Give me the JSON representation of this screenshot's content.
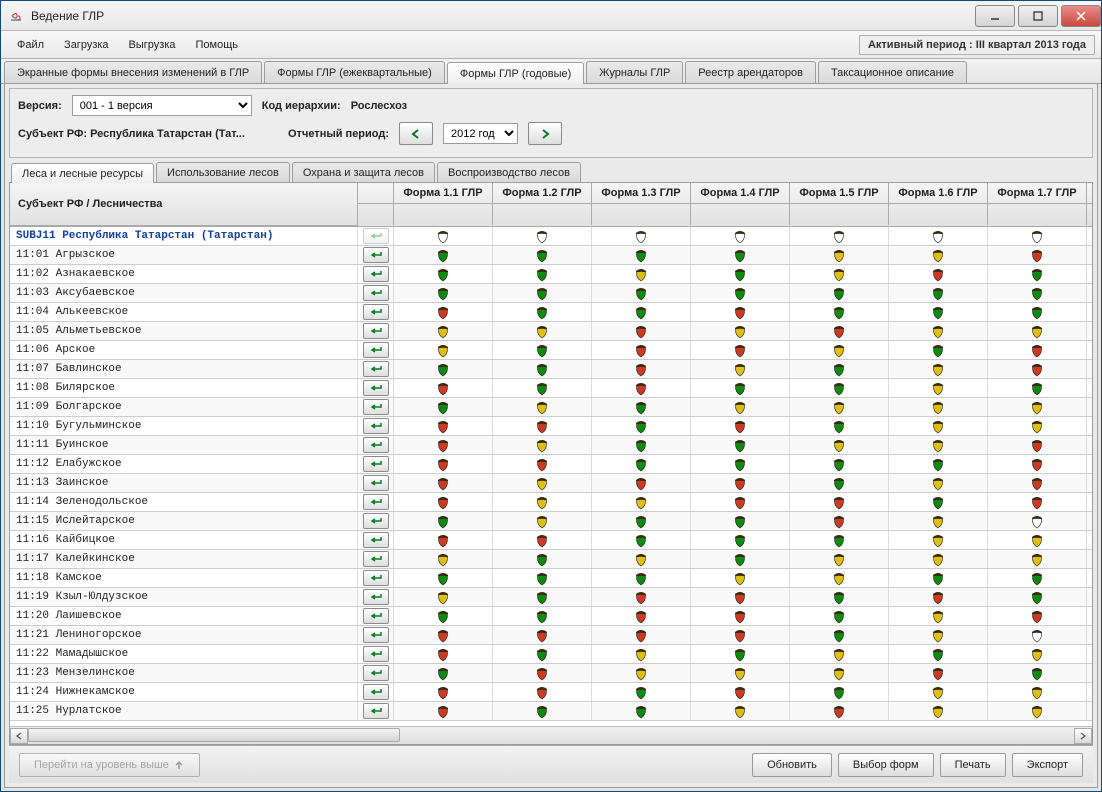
{
  "title": "Ведение ГЛР",
  "menu": [
    "Файл",
    "Загрузка",
    "Выгрузка",
    "Помощь"
  ],
  "active_period": "Активный период : III квартал  2013 года",
  "tabs": [
    "Экранные формы внесения изменений в ГЛР",
    "Формы ГЛР (ежеквартальные)",
    "Формы ГЛР (годовые)",
    "Журналы ГЛР",
    "Реестр арендаторов",
    "Таксационное описание"
  ],
  "tabs_active_index": 2,
  "filters": {
    "version_label": "Версия:",
    "version_value": "001 - 1 версия",
    "hierarchy_label": "Код иерархии:",
    "hierarchy_value": "Рослесхоз",
    "subject_label": "Субъект РФ: Республика Татарстан (Тат...",
    "period_label": "Отчетный период:",
    "period_value": "2012 год"
  },
  "subtabs": [
    "Леса и лесные ресурсы",
    "Использование лесов",
    "Охрана и защита лесов",
    "Воспроизводство лесов"
  ],
  "subtabs_active_index": 0,
  "columns": {
    "subject": "Субъект РФ / Лесничества",
    "forms": [
      "Форма 1.1 ГЛР",
      "Форма 1.2 ГЛР",
      "Форма 1.3 ГЛР",
      "Форма 1.4 ГЛР",
      "Форма 1.5 ГЛР",
      "Форма 1.6 ГЛР",
      "Форма 1.7 ГЛР"
    ]
  },
  "rows": [
    {
      "code": "SUBJ11 Республика Татарстан (Татарстан)",
      "root": true,
      "btn": "disabled",
      "c": [
        "w",
        "w",
        "w",
        "w",
        "w",
        "w",
        "w"
      ]
    },
    {
      "code": "11:01 Агрызское",
      "c": [
        "g",
        "g",
        "g",
        "g",
        "y",
        "y",
        "r"
      ]
    },
    {
      "code": "11:02 Азнакаевское",
      "c": [
        "g",
        "g",
        "y",
        "g",
        "y",
        "r",
        "g"
      ]
    },
    {
      "code": "11:03 Аксубаевское",
      "c": [
        "g",
        "g",
        "g",
        "g",
        "g",
        "g",
        "g"
      ]
    },
    {
      "code": "11:04 Алькеевское",
      "c": [
        "r",
        "g",
        "g",
        "r",
        "g",
        "g",
        "g"
      ]
    },
    {
      "code": "11:05 Альметьевское",
      "c": [
        "y",
        "y",
        "r",
        "y",
        "r",
        "y",
        "y"
      ]
    },
    {
      "code": "11:06 Арское",
      "c": [
        "y",
        "g",
        "r",
        "r",
        "y",
        "g",
        "r"
      ]
    },
    {
      "code": "11:07 Бавлинское",
      "c": [
        "g",
        "g",
        "r",
        "y",
        "g",
        "y",
        "r"
      ]
    },
    {
      "code": "11:08 Билярское",
      "c": [
        "r",
        "g",
        "r",
        "g",
        "g",
        "y",
        "g"
      ]
    },
    {
      "code": "11:09 Болгарское",
      "c": [
        "g",
        "y",
        "g",
        "y",
        "y",
        "y",
        "y"
      ]
    },
    {
      "code": "11:10 Бугульминское",
      "c": [
        "r",
        "r",
        "g",
        "r",
        "g",
        "y",
        "y"
      ]
    },
    {
      "code": "11:11 Буинское",
      "c": [
        "r",
        "y",
        "g",
        "g",
        "y",
        "y",
        "r"
      ]
    },
    {
      "code": "11:12 Елабужское",
      "c": [
        "r",
        "r",
        "g",
        "g",
        "g",
        "g",
        "r"
      ]
    },
    {
      "code": "11:13 Заинское",
      "c": [
        "r",
        "y",
        "r",
        "r",
        "g",
        "y",
        "r"
      ]
    },
    {
      "code": "11:14 Зеленодольское",
      "c": [
        "r",
        "y",
        "y",
        "r",
        "r",
        "g",
        "r"
      ]
    },
    {
      "code": "11:15 Ислейтарское",
      "c": [
        "g",
        "y",
        "g",
        "g",
        "r",
        "y",
        "w"
      ]
    },
    {
      "code": "11:16 Кайбицкое",
      "c": [
        "r",
        "r",
        "g",
        "g",
        "g",
        "y",
        "y"
      ]
    },
    {
      "code": "11:17 Калейкинское",
      "c": [
        "y",
        "g",
        "y",
        "g",
        "y",
        "y",
        "y"
      ]
    },
    {
      "code": "11:18 Камское",
      "c": [
        "g",
        "g",
        "g",
        "y",
        "y",
        "g",
        "g"
      ]
    },
    {
      "code": "11:19 Кзыл-Юлдузское",
      "c": [
        "y",
        "g",
        "r",
        "r",
        "g",
        "r",
        "g"
      ]
    },
    {
      "code": "11:20 Лаишевское",
      "c": [
        "g",
        "g",
        "r",
        "r",
        "g",
        "y",
        "r"
      ]
    },
    {
      "code": "11:21 Лениногорское",
      "c": [
        "r",
        "r",
        "r",
        "r",
        "g",
        "y",
        "w"
      ]
    },
    {
      "code": "11:22 Мамадышское",
      "c": [
        "r",
        "g",
        "y",
        "g",
        "y",
        "g",
        "y"
      ]
    },
    {
      "code": "11:23 Мензелинское",
      "c": [
        "g",
        "r",
        "y",
        "y",
        "y",
        "r",
        "g"
      ]
    },
    {
      "code": "11:24 Нижнекамское",
      "c": [
        "r",
        "r",
        "g",
        "r",
        "g",
        "y",
        "y"
      ]
    },
    {
      "code": "11:25 Нурлатское",
      "c": [
        "r",
        "g",
        "g",
        "y",
        "r",
        "y",
        "y"
      ]
    }
  ],
  "status_colors": {
    "g": "#0e8a0e",
    "y": "#e0bf12",
    "r": "#cc3a21",
    "w": "#ffffff"
  },
  "bottom": {
    "up_level": "Перейти на уровень выше",
    "refresh": "Обновить",
    "choose_forms": "Выбор форм",
    "print": "Печать",
    "export": "Экспорт"
  }
}
